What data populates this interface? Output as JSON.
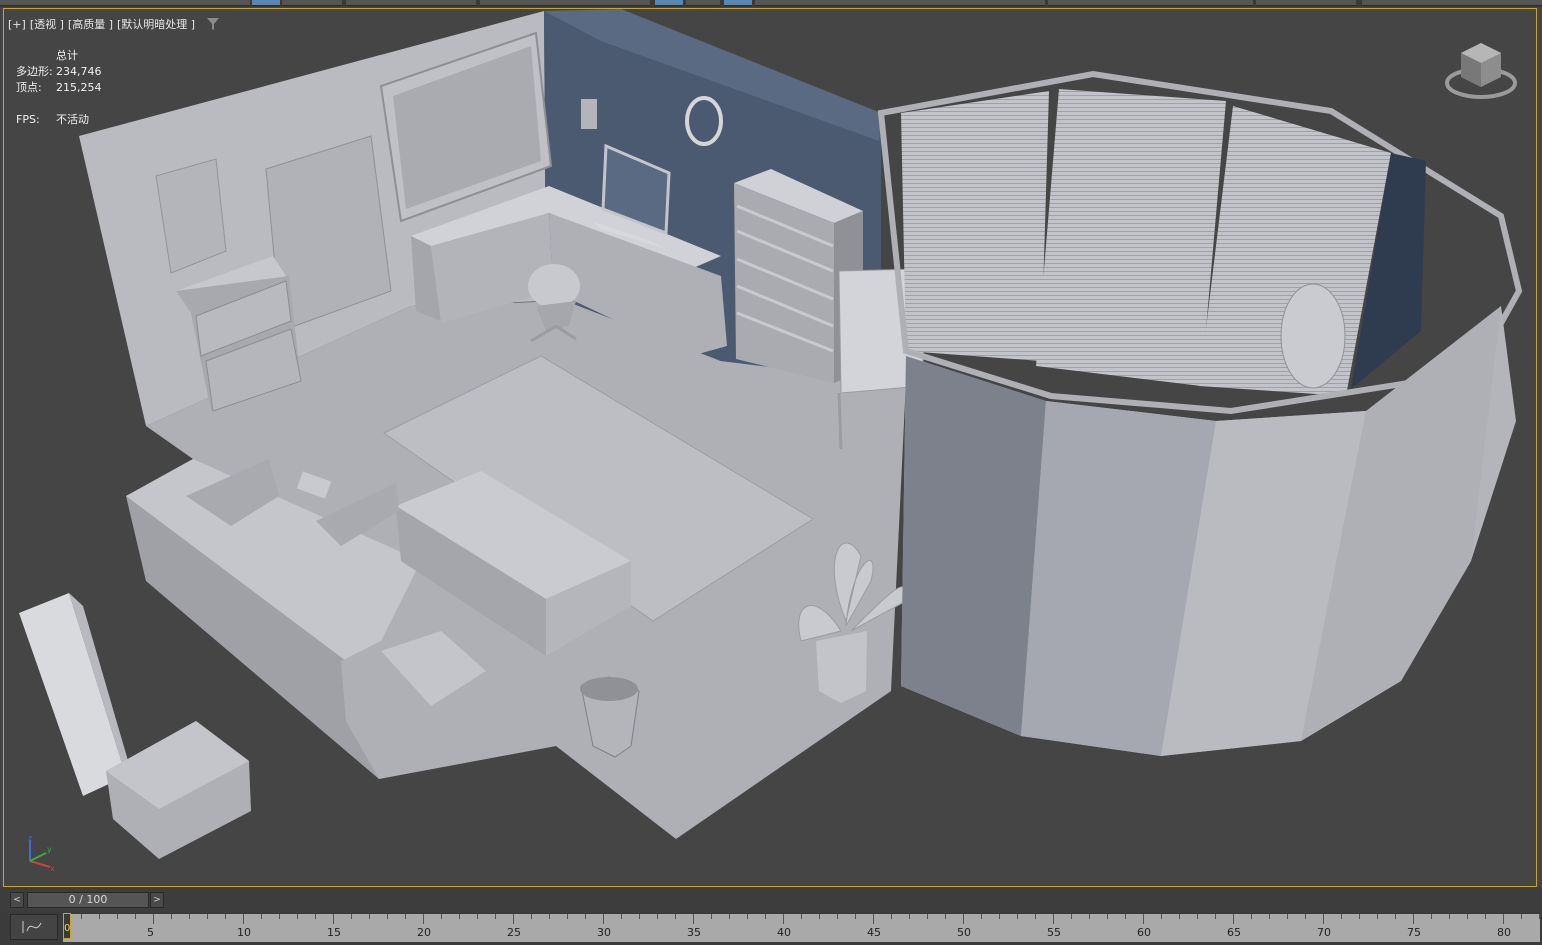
{
  "viewport": {
    "labels": [
      "[+]",
      "[透视 ]",
      "[高质量 ]",
      "[默认明暗处理 ]"
    ],
    "filter_icon": "filter-funnel-icon",
    "stats": {
      "header": "总计",
      "polygons_label": "多边形:",
      "polygons_value": "234,746",
      "vertices_label": "顶点:",
      "vertices_value": "215,254",
      "fps_label": "FPS:",
      "fps_value": "不活动"
    },
    "viewcube_icon": "viewcube-icon",
    "axis_icon": "xyz-axis-tripod-icon",
    "axis_labels": [
      "z",
      "y",
      "x"
    ]
  },
  "time_slider": {
    "prev_icon": "chevron-left-icon",
    "next_icon": "chevron-right-icon",
    "prev_label": "<",
    "next_label": ">",
    "value": "0 / 100"
  },
  "trackbar": {
    "curve_icon": "mini-curve-editor-icon",
    "current_frame": "0",
    "tick_labels": [
      "5",
      "10",
      "15",
      "20",
      "25",
      "30",
      "35",
      "40",
      "45",
      "50",
      "55",
      "60",
      "65",
      "70",
      "75",
      "80"
    ]
  },
  "colors": {
    "viewport_border": "#c9a52c",
    "viewport_bg": "#454545",
    "wall_blue": "#4b5a71",
    "model_gray": "#b8bac0"
  }
}
